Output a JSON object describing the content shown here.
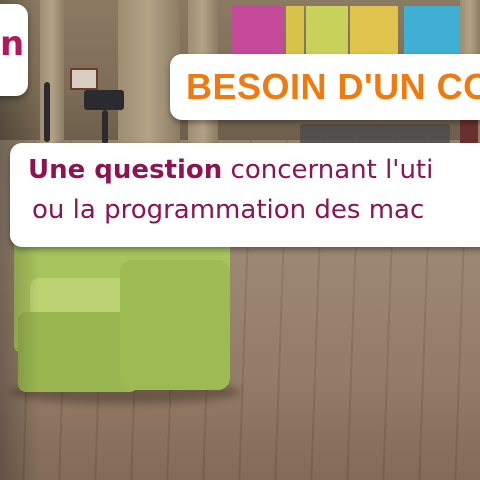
{
  "scene": {
    "colors": {
      "caption_orange": "#f07a0e",
      "caption_purple": "#8c1453",
      "caption_magenta": "#b5175b",
      "caption_background": "#ffffff",
      "armchair_green": "#a8c45e",
      "floor_wood": "#8f7f6c"
    }
  },
  "captions": {
    "left_partial": "n",
    "title": "BESOIN D'UN CO",
    "question": {
      "line1_bold": "Une question",
      "line1_rest": " concernant l'uti",
      "line2": "ou la programmation des mac"
    }
  }
}
